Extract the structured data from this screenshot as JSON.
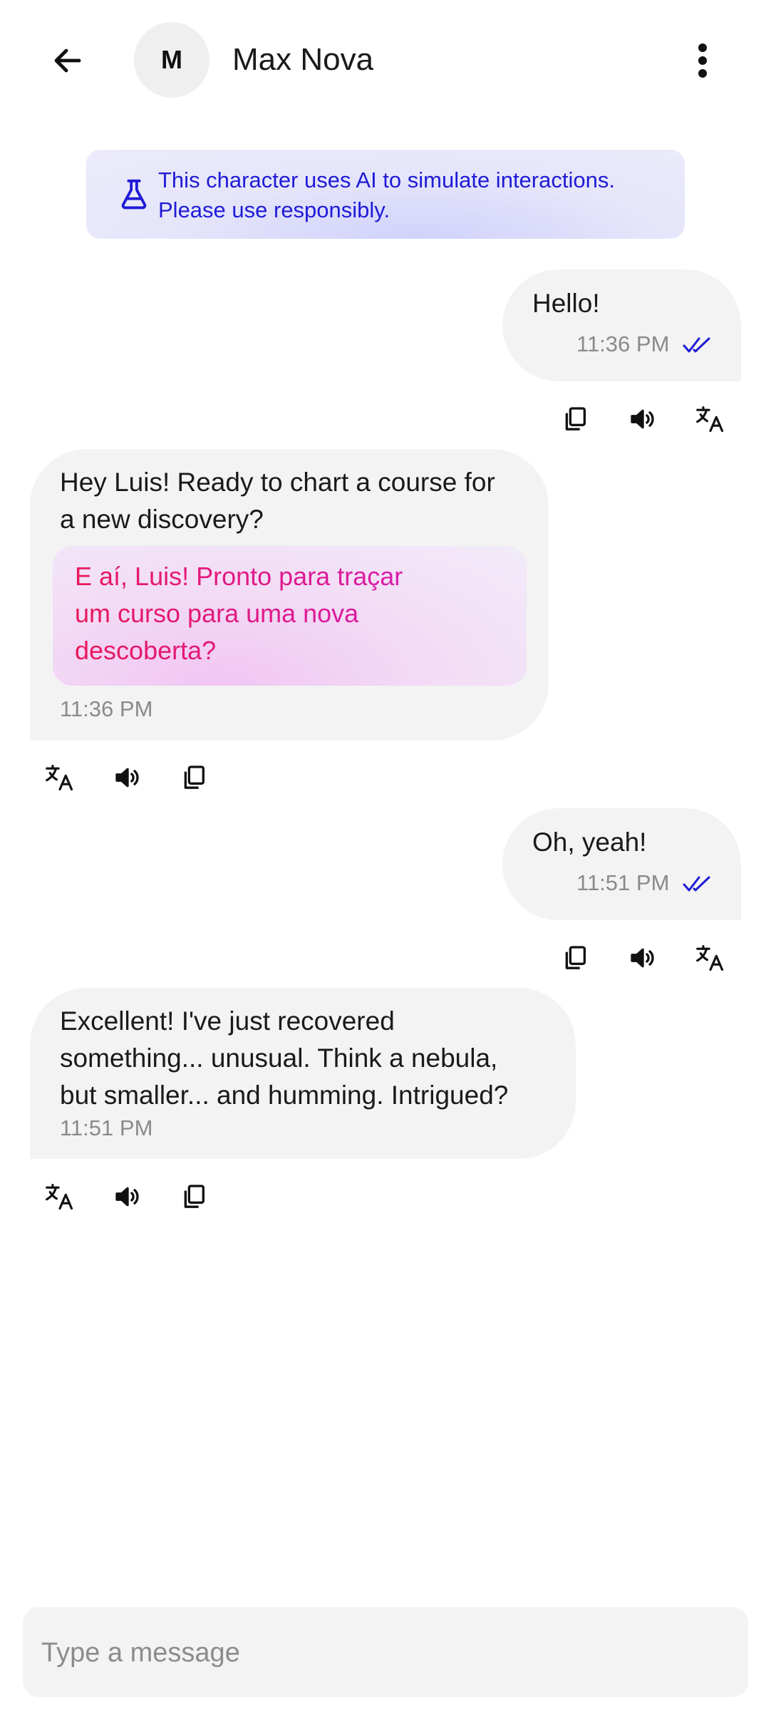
{
  "header": {
    "avatar_initial": "M",
    "contact_name": "Max Nova",
    "back_icon": "arrow-left-icon",
    "menu_icon": "more-vertical-icon"
  },
  "disclaimer": {
    "icon": "flask-icon",
    "line1": "This character uses AI to simulate interactions.",
    "line2": "Please use responsibly."
  },
  "messages": [
    {
      "direction": "outgoing",
      "text": "Hello!",
      "time": "11:36 PM",
      "status": "read"
    },
    {
      "direction": "incoming",
      "lines": [
        "Hey Luis! Ready to chart a course for",
        "a new discovery?"
      ],
      "translation": [
        "E aí, Luis! Pronto para traçar",
        "um curso para uma nova",
        "descoberta?"
      ],
      "time": "11:36 PM"
    },
    {
      "direction": "outgoing",
      "text": "Oh, yeah!",
      "time": "11:51 PM",
      "status": "read"
    },
    {
      "direction": "incoming",
      "lines": [
        "Excellent! I've just recovered",
        "something... unusual. Think a nebula,",
        "but smaller... and humming. Intrigued?"
      ],
      "time": "11:51 PM"
    }
  ],
  "actions": {
    "copy_icon": "copy-icon",
    "speaker_icon": "speaker-icon",
    "translate_icon": "translate-icon"
  },
  "composer": {
    "placeholder": "Type a message",
    "value": ""
  },
  "colors": {
    "accent": "#1f1bd6",
    "bubble": "#f3f3f3",
    "translation_text": "#e8185a"
  }
}
